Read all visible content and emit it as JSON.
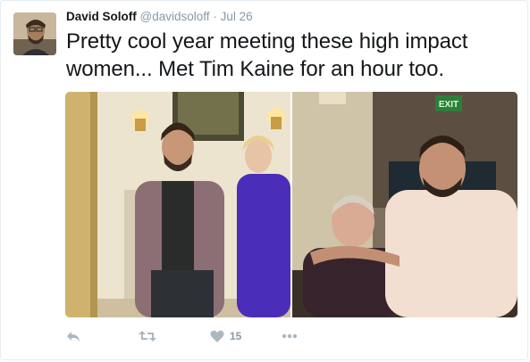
{
  "tweet": {
    "display_name": "David Soloff",
    "handle": "@davidsoloff",
    "separator": "·",
    "time": "Jul 26",
    "text": "Pretty cool year meeting these high impact women... Met Tim Kaine for an hour too."
  },
  "photos": [
    {
      "kind": "photo",
      "subject": "two people posing by fireplace"
    },
    {
      "kind": "photo",
      "subject": "two people posing under exit sign",
      "sign_text": "EXIT"
    }
  ],
  "actions": {
    "like_count": "15",
    "reply_icon": "reply-icon",
    "retweet_icon": "retweet-icon",
    "like_icon": "heart-icon",
    "more_icon": "more-icon"
  },
  "colors": {
    "text": "#14171a",
    "secondary": "#8899a6",
    "icon": "#aab8c2",
    "border": "#e6ecf0"
  }
}
